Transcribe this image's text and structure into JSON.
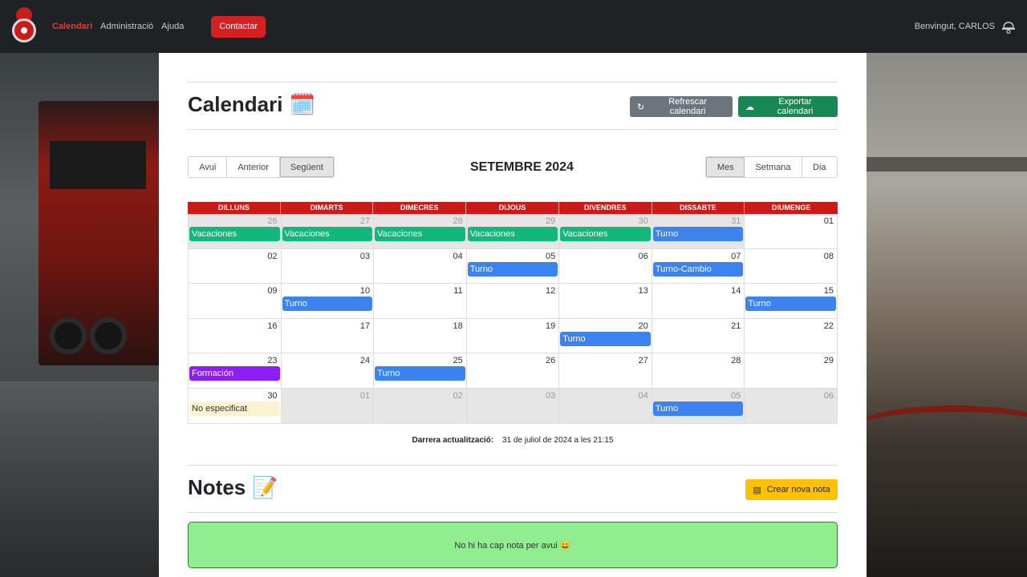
{
  "colors": {
    "navbar": "#1f2225",
    "accent_red": "#d32020",
    "header_red": "#cc1a1a",
    "vacaciones": "#13b77b",
    "turno": "#3c83f0",
    "formacion": "#8b1ef2",
    "no_especificat": "#fbf3cf",
    "notes_bg": "#90ee90"
  },
  "navbar": {
    "links": [
      "Calendari",
      "Administració",
      "Ajuda"
    ],
    "contact_label": "Contactar",
    "welcome": "Benvingut, CARLOS",
    "user_icon": "firefighter-helmet-icon"
  },
  "calendar_section": {
    "title": "Calendari",
    "title_icon": "🗓️",
    "refresh_label": "Refrescar calendari",
    "export_label": "Exportar calendari",
    "nav_buttons": [
      "Avui",
      "Anterior",
      "Següent"
    ],
    "selected_nav": "Següent",
    "month_title": "SETEMBRE 2024",
    "view_buttons": [
      "Mes",
      "Setmana",
      "Dia"
    ],
    "selected_view": "Mes",
    "weekdays": [
      "DILLUNS",
      "DIMARTS",
      "DIMECRES",
      "DIJOUS",
      "DIVENDRES",
      "DISSABTE",
      "DIUMENGE"
    ],
    "weeks": [
      [
        {
          "day": "26",
          "other": true,
          "event": "Vacaciones",
          "type": "vac"
        },
        {
          "day": "27",
          "other": true,
          "event": "Vacaciones",
          "type": "vac"
        },
        {
          "day": "28",
          "other": true,
          "event": "Vacaciones",
          "type": "vac"
        },
        {
          "day": "29",
          "other": true,
          "event": "Vacaciones",
          "type": "vac"
        },
        {
          "day": "30",
          "other": true,
          "event": "Vacaciones",
          "type": "vac"
        },
        {
          "day": "31",
          "other": true,
          "event": "Turno",
          "type": "turno"
        },
        {
          "day": "01",
          "other": false,
          "event": "",
          "type": ""
        }
      ],
      [
        {
          "day": "02",
          "other": false,
          "event": "",
          "type": ""
        },
        {
          "day": "03",
          "other": false,
          "event": "",
          "type": ""
        },
        {
          "day": "04",
          "other": false,
          "event": "",
          "type": ""
        },
        {
          "day": "05",
          "other": false,
          "event": "Turno",
          "type": "turno"
        },
        {
          "day": "06",
          "other": false,
          "event": "",
          "type": ""
        },
        {
          "day": "07",
          "other": false,
          "event": "Turno-Cambio",
          "type": "turno"
        },
        {
          "day": "08",
          "other": false,
          "event": "",
          "type": ""
        }
      ],
      [
        {
          "day": "09",
          "other": false,
          "event": "",
          "type": ""
        },
        {
          "day": "10",
          "other": false,
          "event": "Turno",
          "type": "turno"
        },
        {
          "day": "11",
          "other": false,
          "event": "",
          "type": ""
        },
        {
          "day": "12",
          "other": false,
          "event": "",
          "type": ""
        },
        {
          "day": "13",
          "other": false,
          "event": "",
          "type": ""
        },
        {
          "day": "14",
          "other": false,
          "event": "",
          "type": ""
        },
        {
          "day": "15",
          "other": false,
          "event": "Turno",
          "type": "turno"
        }
      ],
      [
        {
          "day": "16",
          "other": false,
          "event": "",
          "type": ""
        },
        {
          "day": "17",
          "other": false,
          "event": "",
          "type": ""
        },
        {
          "day": "18",
          "other": false,
          "event": "",
          "type": ""
        },
        {
          "day": "19",
          "other": false,
          "event": "",
          "type": ""
        },
        {
          "day": "20",
          "other": false,
          "event": "Turno",
          "type": "turno"
        },
        {
          "day": "21",
          "other": false,
          "event": "",
          "type": ""
        },
        {
          "day": "22",
          "other": false,
          "event": "",
          "type": ""
        }
      ],
      [
        {
          "day": "23",
          "other": false,
          "event": "Formación",
          "type": "form"
        },
        {
          "day": "24",
          "other": false,
          "event": "",
          "type": ""
        },
        {
          "day": "25",
          "other": false,
          "event": "Turno",
          "type": "turno"
        },
        {
          "day": "26",
          "other": false,
          "event": "",
          "type": ""
        },
        {
          "day": "27",
          "other": false,
          "event": "",
          "type": ""
        },
        {
          "day": "28",
          "other": false,
          "event": "",
          "type": ""
        },
        {
          "day": "29",
          "other": false,
          "event": "",
          "type": ""
        }
      ],
      [
        {
          "day": "30",
          "other": false,
          "event": "No especificat",
          "type": "ne"
        },
        {
          "day": "01",
          "other": true,
          "event": "",
          "type": ""
        },
        {
          "day": "02",
          "other": true,
          "event": "",
          "type": ""
        },
        {
          "day": "03",
          "other": true,
          "event": "",
          "type": ""
        },
        {
          "day": "04",
          "other": true,
          "event": "",
          "type": ""
        },
        {
          "day": "05",
          "other": true,
          "event": "Turno",
          "type": "turno"
        },
        {
          "day": "06",
          "other": true,
          "event": "",
          "type": ""
        }
      ]
    ],
    "last_update_label": "Darrera actualització:",
    "last_update_value": "31 de juliol de 2024 a les 21:15"
  },
  "notes_section": {
    "title": "Notes",
    "title_icon": "📝",
    "create_label": "Crear nova nota",
    "empty_message": "No hi ha cap nota per avui 😀"
  }
}
